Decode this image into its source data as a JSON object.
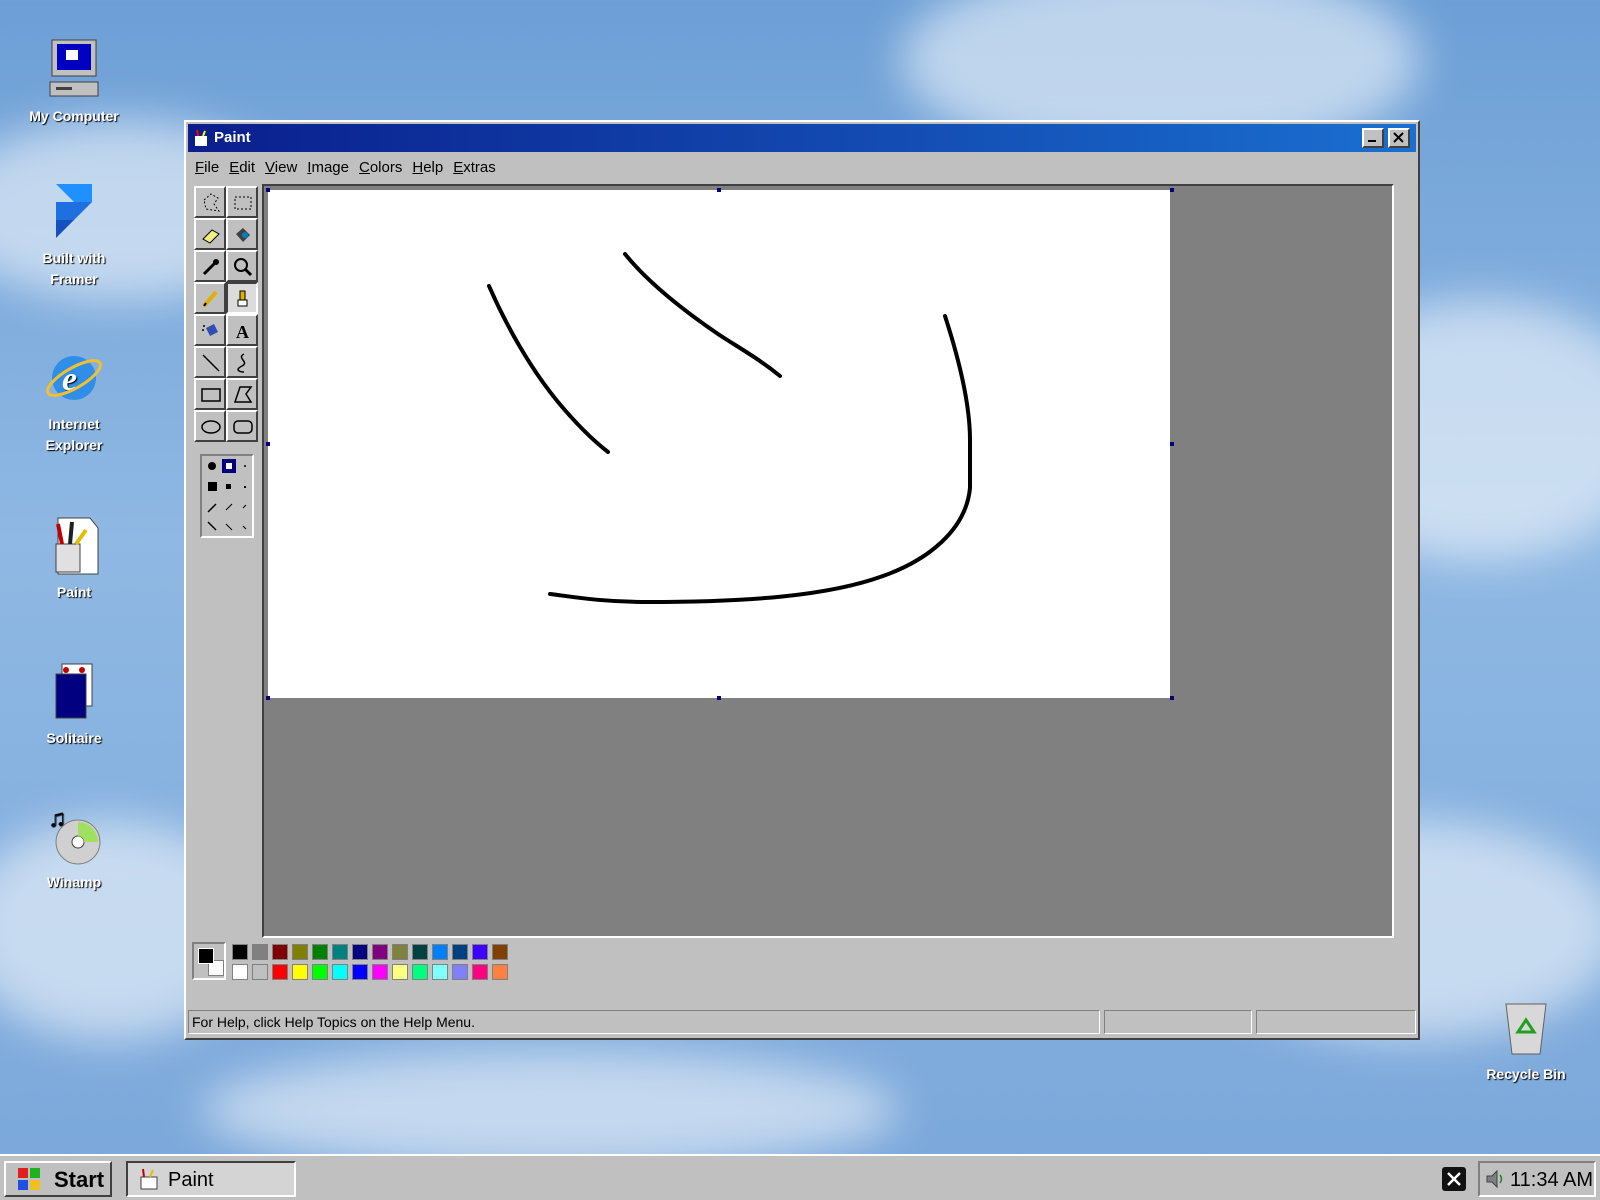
{
  "desktop": {
    "icons": [
      {
        "label": "My Computer"
      },
      {
        "label": "Built with Framer"
      },
      {
        "label": "Internet Explorer"
      },
      {
        "label": "Paint"
      },
      {
        "label": "Solitaire"
      },
      {
        "label": "Winamp"
      },
      {
        "label": "Recycle Bin"
      }
    ]
  },
  "window": {
    "title": "Paint",
    "menu": [
      "File",
      "Edit",
      "View",
      "Image",
      "Colors",
      "Help",
      "Extras"
    ],
    "selected_tool": "brush",
    "status_text": "For Help, click Help Topics on the Help Menu.",
    "palette": {
      "foreground": "#000000",
      "background": "#ffffff",
      "row1": [
        "#000000",
        "#808080",
        "#800000",
        "#808000",
        "#008000",
        "#008080",
        "#000080",
        "#800080",
        "#808040",
        "#004040",
        "#0080ff",
        "#004080",
        "#4000ff",
        "#804000"
      ],
      "row2": [
        "#ffffff",
        "#c0c0c0",
        "#ff0000",
        "#ffff00",
        "#00ff00",
        "#00ffff",
        "#0000ff",
        "#ff00ff",
        "#ffff80",
        "#00ff80",
        "#80ffff",
        "#8080ff",
        "#ff0080",
        "#ff8040"
      ]
    }
  },
  "taskbar": {
    "start_label": "Start",
    "task_label": "Paint",
    "clock": "11:34 AM"
  },
  "colors": {
    "title_start": "#0a1e8c",
    "title_end": "#1a6fd0",
    "face": "#c0c0c0",
    "workspace": "#808080"
  }
}
